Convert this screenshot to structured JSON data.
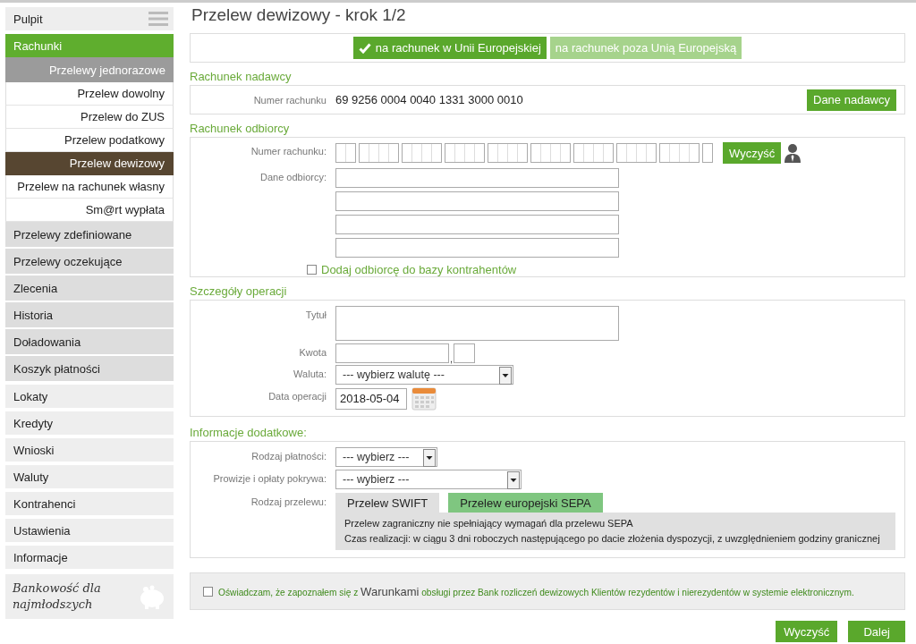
{
  "sidebar": {
    "items": [
      {
        "label": "Pulpit",
        "kind": "menu",
        "selected": false
      },
      {
        "label": "Rachunki",
        "kind": "link",
        "selected": true,
        "children": [
          {
            "label": "Przelewy jednorazowe",
            "selected": false,
            "expanded": true,
            "children": [
              {
                "label": "Przelew dowolny",
                "selected": false
              },
              {
                "label": "Przelew do ZUS",
                "selected": false
              },
              {
                "label": "Przelew podatkowy",
                "selected": false
              },
              {
                "label": "Przelew dewizowy",
                "selected": true
              },
              {
                "label": "Przelew na rachunek własny",
                "selected": false
              },
              {
                "label": "Sm@rt wypłata",
                "selected": false
              }
            ]
          },
          {
            "label": "Przelewy zdefiniowane",
            "selected": false
          },
          {
            "label": "Przelewy oczekujące",
            "selected": false
          },
          {
            "label": "Zlecenia",
            "selected": false
          },
          {
            "label": "Historia",
            "selected": false
          },
          {
            "label": "Doładowania",
            "selected": false
          },
          {
            "label": "Koszyk płatności",
            "selected": false
          }
        ]
      },
      {
        "label": "Lokaty",
        "kind": "link",
        "selected": false
      },
      {
        "label": "Kredyty",
        "kind": "link",
        "selected": false
      },
      {
        "label": "Wnioski",
        "kind": "link",
        "selected": false
      },
      {
        "label": "Waluty",
        "kind": "link",
        "selected": false
      },
      {
        "label": "Kontrahenci",
        "kind": "link",
        "selected": false
      },
      {
        "label": "Ustawienia",
        "kind": "link",
        "selected": false
      },
      {
        "label": "Informacje",
        "kind": "link",
        "selected": false
      }
    ],
    "promo": {
      "text": "Bankowość dla najmłodszych"
    }
  },
  "page": {
    "title": "Przelew dewizowy - krok 1/2"
  },
  "destination_tabs": [
    {
      "label": "na rachunek w Unii Europejskiej",
      "selected": true
    },
    {
      "label": "na rachunek poza Unią Europejską",
      "selected": false
    }
  ],
  "sender": {
    "heading": "Rachunek nadawcy",
    "label": "Numer rachunku",
    "account_number": "69 9256 0004 0040 1331 3000 0010",
    "button": "Dane nadawcy"
  },
  "recipient": {
    "heading": "Rachunek odbiorcy",
    "account_label": "Numer rachunku:",
    "clear_button": "Wyczyść",
    "details_label": "Dane odbiorcy:",
    "save_checkbox": {
      "label": "Dodaj odbiorcę do bazy kontrahentów",
      "checked": false
    }
  },
  "operation": {
    "heading": "Szczegóły operacji",
    "title_label": "Tytuł",
    "amount_label": "Kwota",
    "amount_separator": ",",
    "currency_label": "Waluta:",
    "currency_select": "--- wybierz walutę ---",
    "date_label": "Data operacji",
    "date_value": "2018-05-04"
  },
  "additional": {
    "heading": "Informacje dodatkowe:",
    "payment_type_label": "Rodzaj płatności:",
    "payment_type_select": "--- wybierz ---",
    "fees_label": "Prowizje i opłaty pokrywa:",
    "fees_select": "--- wybierz ---",
    "transfer_type_label": "Rodzaj przelewu:",
    "transfer_tabs": [
      {
        "label": "Przelew SWIFT",
        "selected": true
      },
      {
        "label": "Przelew europejski SEPA",
        "selected": false
      }
    ],
    "transfer_info": [
      "Przelew zagraniczny nie spełniający wymagań dla przelewu SEPA",
      "Czas realizacji: w ciągu 3 dni roboczych następującego po dacie złożenia dyspozycji, z uwzględnieniem godziny granicznej"
    ]
  },
  "consent": {
    "checked": false,
    "text_before": "Oświadczam, że zapoznałem się z",
    "link": "Warunkami",
    "text_after": "obsługi przez Bank rozliczeń dewizowych Klientów rezydentów i nierezydentów w systemie elektronicznym."
  },
  "buttons": [
    "Wyczyść",
    "Dalej"
  ]
}
